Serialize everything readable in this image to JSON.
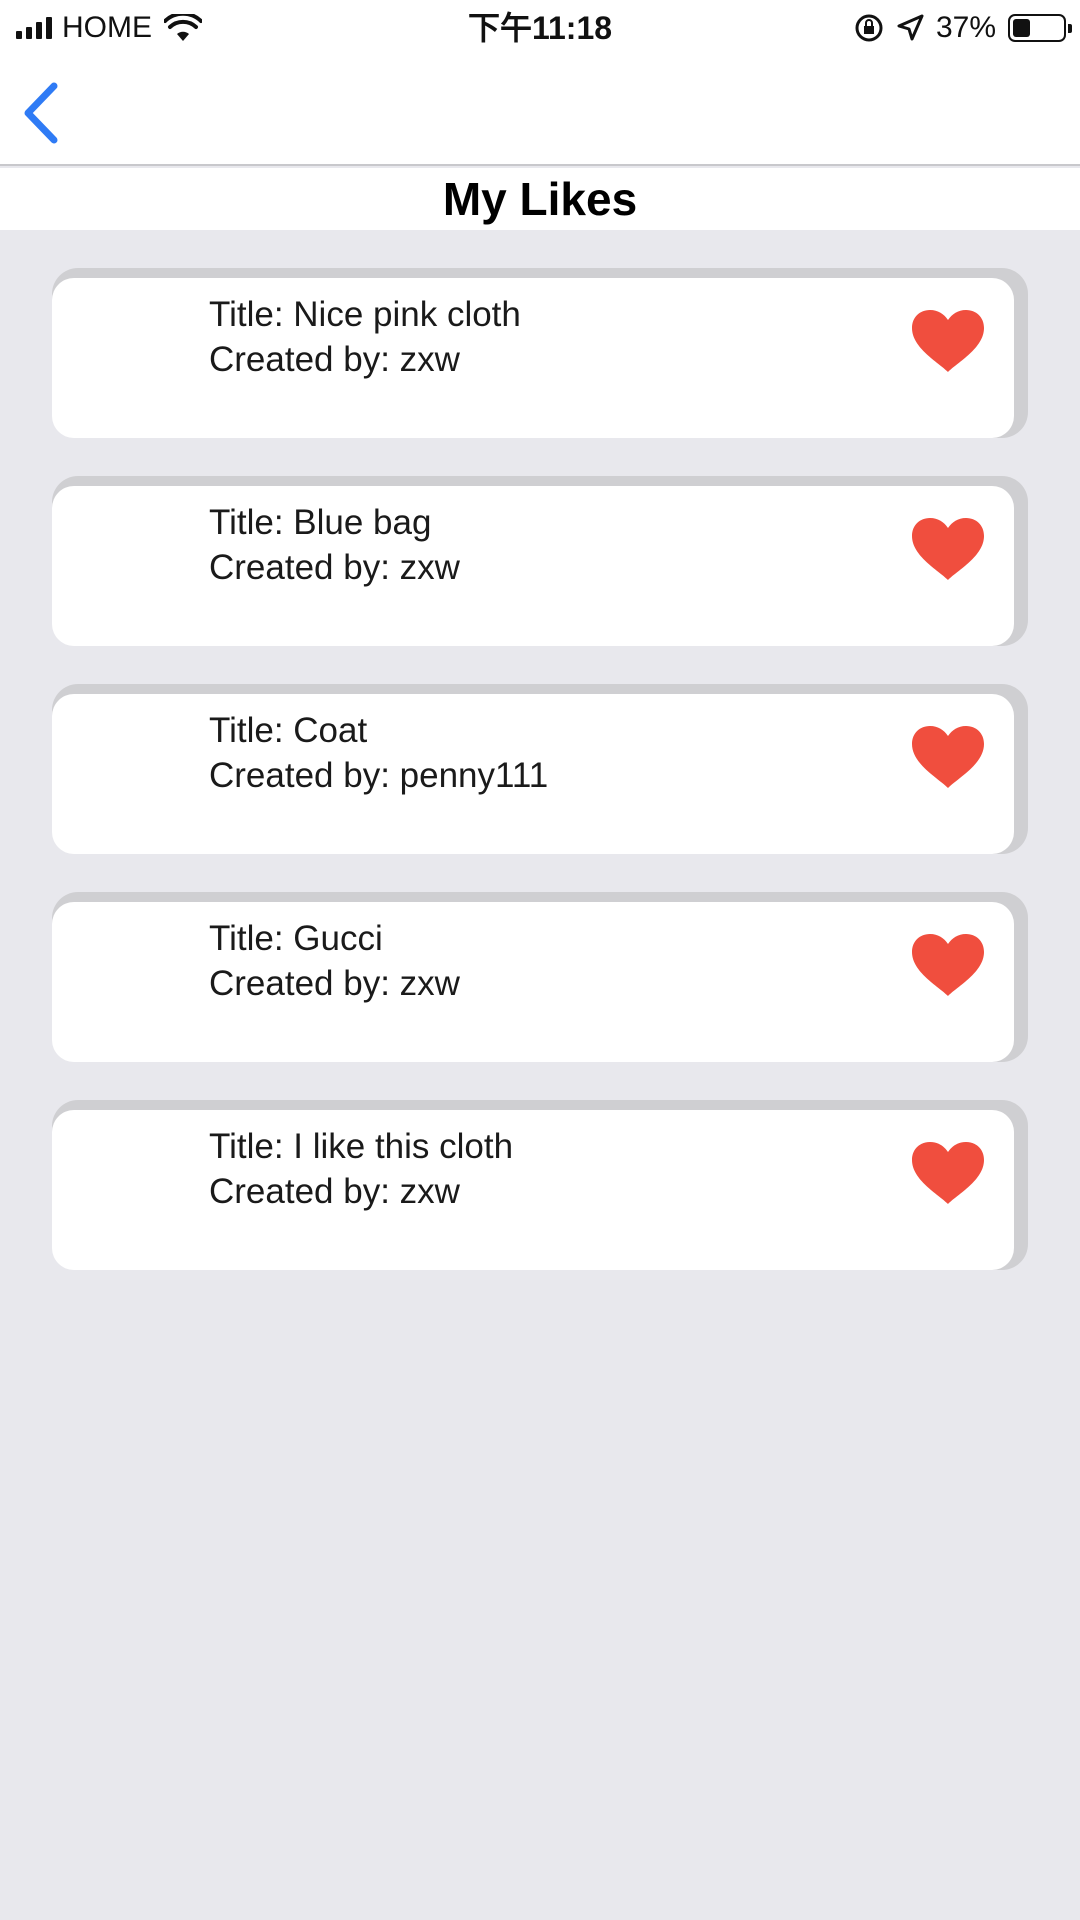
{
  "status_bar": {
    "carrier": "HOME",
    "time": "下午11:18",
    "battery_percent": "37%",
    "battery_level": 0.37
  },
  "nav": {
    "back_icon": "chevron-left-icon",
    "accent_color": "#2f7bf5"
  },
  "page": {
    "title": "My Likes"
  },
  "likes": [
    {
      "title": "Title: Nice pink cloth",
      "creator": "Created by: zxw",
      "liked": true
    },
    {
      "title": "Title: Blue bag",
      "creator": "Created by: zxw",
      "liked": true
    },
    {
      "title": "Title: Coat",
      "creator": "Created by: penny111",
      "liked": true
    },
    {
      "title": "Title: Gucci",
      "creator": "Created by: zxw",
      "liked": true
    },
    {
      "title": "Title: I like this cloth",
      "creator": "Created by: zxw",
      "liked": true
    }
  ],
  "colors": {
    "heart": "#f04e3e",
    "background": "#e8e8ed"
  }
}
